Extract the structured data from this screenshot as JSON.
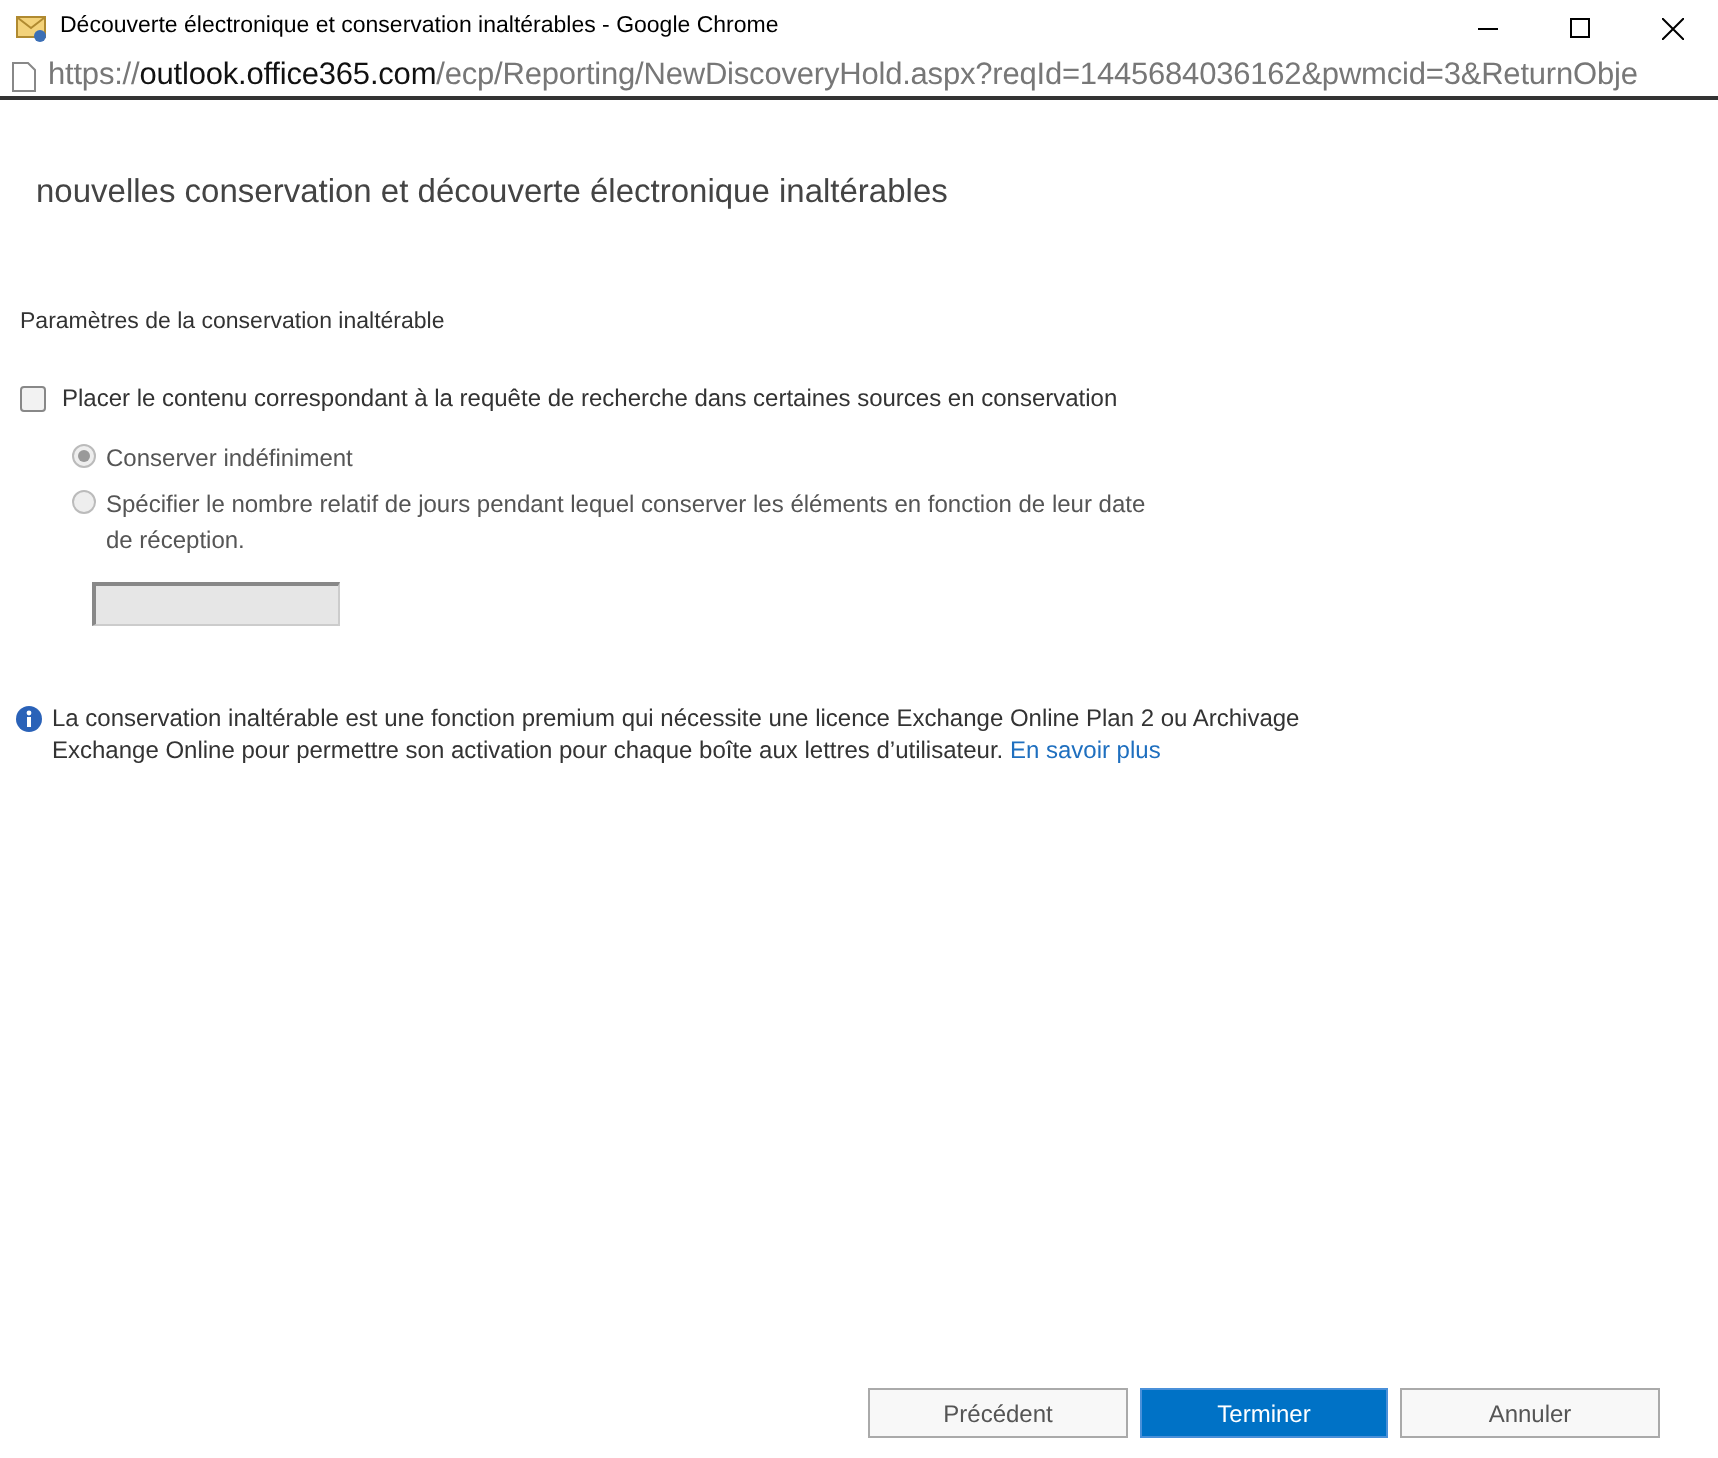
{
  "window": {
    "title": "Découverte électronique et conservation inaltérables - Google Chrome"
  },
  "address_bar": {
    "scheme": "https://",
    "host": "outlook.office365.com",
    "path": "/ecp/Reporting/NewDiscoveryHold.aspx?reqId=1445684036162&pwmcid=3&ReturnObje"
  },
  "heading": "nouvelles conservation et découverte électronique inaltérables",
  "section_label": "Paramètres de la conservation inaltérable",
  "hold_checkbox": {
    "label": "Placer le contenu correspondant à la requête de recherche dans certaines sources en conservation",
    "checked": false
  },
  "options": [
    {
      "label": "Conserver indéfiniment",
      "selected": true,
      "disabled": true
    },
    {
      "label": "Spécifier le nombre relatif de jours pendant lequel conserver les éléments en fonction de leur date de réception.",
      "selected": false,
      "disabled": true
    }
  ],
  "days_field": {
    "disabled": true
  },
  "info": {
    "text": "La conservation inaltérable est une fonction premium qui nécessite une licence Exchange Online Plan 2 ou Archivage Exchange Online pour permettre son activation pour chaque boîte aux lettres d’utilisateur.",
    "link": "En savoir plus"
  },
  "buttons": [
    {
      "label": "Précédent",
      "primary": false
    },
    {
      "label": "Terminer",
      "primary": true
    },
    {
      "label": "Annuler",
      "primary": false
    }
  ]
}
